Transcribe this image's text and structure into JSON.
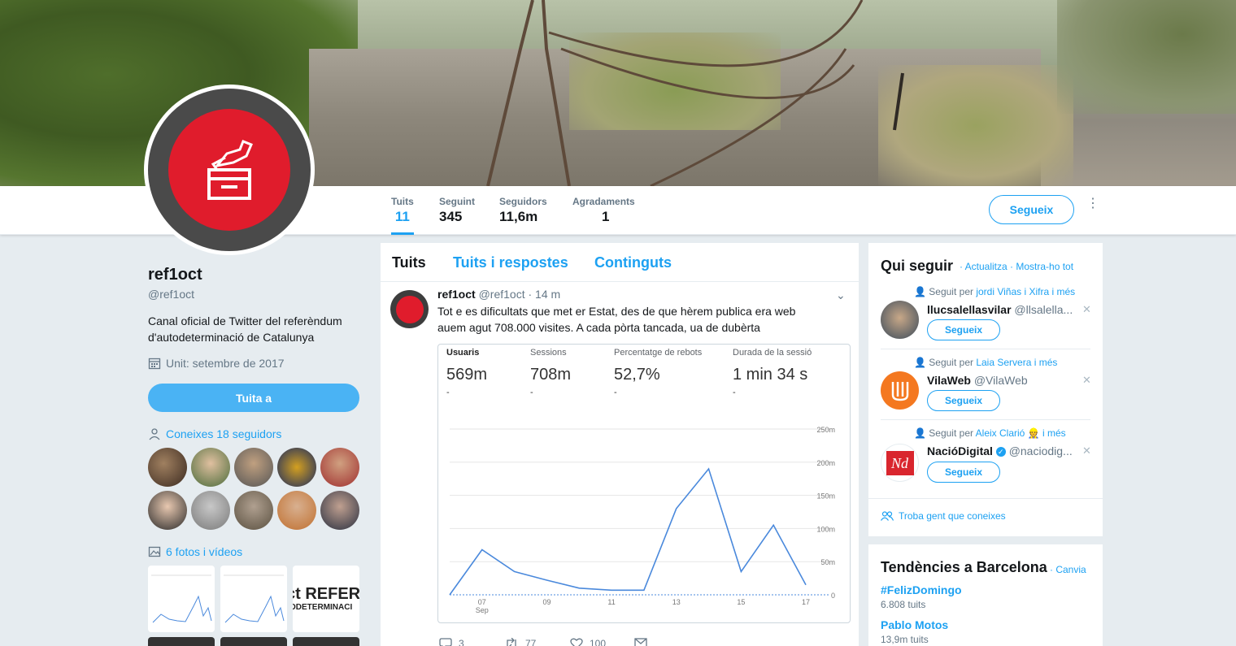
{
  "profile": {
    "name": "ref1oct",
    "handle": "@ref1oct",
    "bio": "Canal oficial de Twitter del referèndum d'autodeterminació de Catalunya",
    "joined": "Unit: setembre de 2017",
    "tweet_to_label": "Tuita a",
    "known_followers": "Coneixes 18 seguidors",
    "photos_link": "6 fotos i vídeos",
    "thumb_text_1": "ct REFER",
    "thumb_text_2": "ODETERMINACI"
  },
  "nav": {
    "stats": [
      {
        "label": "Tuits",
        "value": "11"
      },
      {
        "label": "Seguint",
        "value": "345"
      },
      {
        "label": "Seguidors",
        "value": "11,6m"
      },
      {
        "label": "Agradaments",
        "value": "1"
      }
    ],
    "follow_label": "Segueix",
    "more_glyph": "⋮"
  },
  "timeline": {
    "tabs": [
      "Tuits",
      "Tuits i respostes",
      "Continguts"
    ],
    "tweet": {
      "name": "ref1oct",
      "meta": "@ref1oct · 14 m",
      "chevron": "⌄",
      "text": "Tot e es dificultats que met er Estat, des de que hèrem publica era web auem agut 708.000 visites. A cada pòrta tancada, ua de dubèrta",
      "metrics": [
        {
          "label": "Usuaris",
          "value": "569m",
          "delta": "-"
        },
        {
          "label": "Sessions",
          "value": "708m",
          "delta": "-"
        },
        {
          "label": "Percentatge de rebots",
          "value": "52,7%",
          "delta": "-"
        },
        {
          "label": "Durada de la sessió",
          "value": "1 min 34 s",
          "delta": "-"
        }
      ],
      "actions": {
        "reply": "3",
        "retweet": "77",
        "like": "100"
      }
    }
  },
  "who_to_follow": {
    "title": "Qui seguir",
    "refresh": "· Actualitza · Mostra-ho tot",
    "suggestions": [
      {
        "ctx_prefix": "Seguit per",
        "ctx_users": "jordi Viñas i Xifra",
        "ctx_suffix": "i més",
        "name": "llucsalellasvilar",
        "handle": "@llsalella...",
        "button": "Segueix"
      },
      {
        "ctx_prefix": "Seguit per",
        "ctx_users": "Laia Servera",
        "ctx_suffix": "i més",
        "name": "VilaWeb",
        "handle": "@VilaWeb",
        "button": "Segueix"
      },
      {
        "ctx_prefix": "Seguit per",
        "ctx_users": "Aleix Clarió 👷",
        "ctx_suffix": "i més",
        "name": "NacióDigital",
        "handle": "@naciodig...",
        "button": "Segueix"
      }
    ],
    "find_people": "Troba gent que coneixes"
  },
  "trends": {
    "title": "Tendències a Barcelona",
    "change": "· Canvia",
    "items": [
      {
        "name": "#FelizDomingo",
        "count": "6.808 tuits"
      },
      {
        "name": "Pablo Motos",
        "count": "13,9m tuits"
      }
    ]
  },
  "chart_data": {
    "type": "line",
    "x": [
      "06 Sep",
      "07 Sep",
      "08 Sep",
      "09 Sep",
      "10 Sep",
      "11 Sep",
      "12 Sep",
      "13 Sep",
      "14 Sep",
      "15 Sep",
      "16 Sep",
      "17 Sep"
    ],
    "x_tick_labels": [
      "07",
      "09",
      "11",
      "13",
      "15",
      "17"
    ],
    "x_sub_label": "Sep",
    "series": [
      {
        "values": [
          0,
          68,
          35,
          22,
          10,
          7,
          7,
          130,
          190,
          35,
          105,
          15
        ]
      }
    ],
    "y_tick_labels": [
      "250m",
      "200m",
      "150m",
      "100m",
      "50m",
      "0"
    ],
    "ylim": [
      0,
      250
    ],
    "grid": true,
    "color": "#4a89dc"
  },
  "colors": {
    "accent": "#1da1f2",
    "brand_red": "#e01c2c"
  }
}
